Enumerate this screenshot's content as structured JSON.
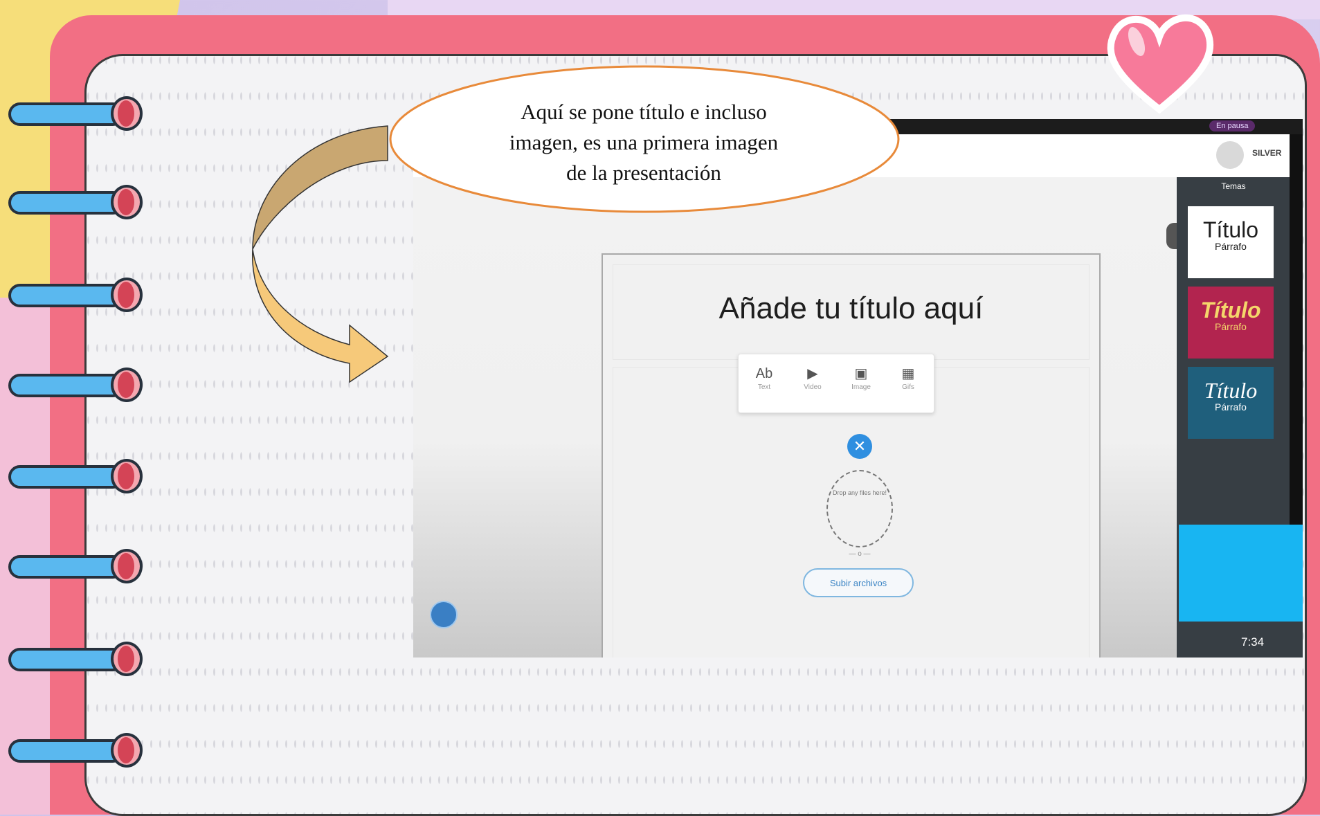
{
  "callout": {
    "line1": "Aquí se pone título e incluso",
    "line2": "imagen, es una primera imagen",
    "line3": "de la presentación"
  },
  "screenshot": {
    "status": {
      "pause_label": "En pausa"
    },
    "appbar": {
      "user_label": "SILVER"
    },
    "slide": {
      "title": "Añade tu título aquí"
    },
    "insert_menu": [
      {
        "icon": "text-icon",
        "glyph": "Ab",
        "label": "Text"
      },
      {
        "icon": "video-icon",
        "glyph": "▶",
        "label": "Video"
      },
      {
        "icon": "image-icon",
        "glyph": "▣",
        "label": "Image"
      },
      {
        "icon": "gif-icon",
        "glyph": "▦",
        "label": "Gifs"
      }
    ],
    "drop": {
      "text": "Drop any files here!",
      "or": "o"
    },
    "upload_button": "Subir archivos",
    "themes": {
      "title": "Temas",
      "cards": [
        {
          "title": "Título",
          "para": "Párrafo",
          "bg": "#ffffff",
          "fg": "#1e1e1e"
        },
        {
          "title": "Título",
          "para": "Párrafo",
          "bg": "#b2244f",
          "fg": "#f4d66b"
        },
        {
          "title": "Título",
          "para": "Párrafo",
          "bg": "#1f5f7c",
          "fg": "#ffffff"
        }
      ]
    },
    "timer": "7:34"
  },
  "colors": {
    "notebook": "#f26f84",
    "ring": "#5ab8ef",
    "callout_border": "#e88a3a",
    "arrow_fill": "#f6c97a"
  }
}
